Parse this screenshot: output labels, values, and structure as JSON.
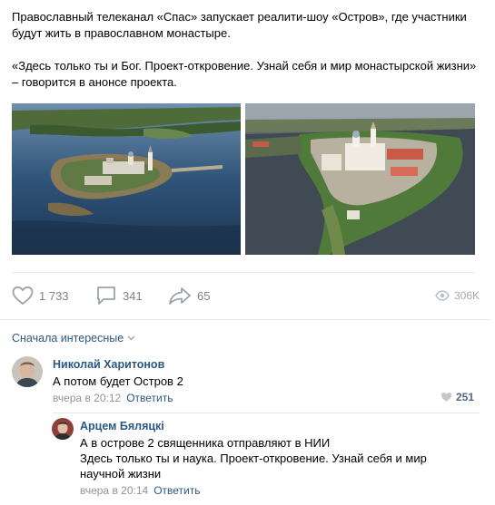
{
  "post": {
    "paragraph_1": "Православный телеканал «Спас» запускает реалити-шоу «Остров», где участники будут жить в православном монастыре.",
    "paragraph_2": "«Здесь только ты и Бог. Проект-откровение. Узнай себя и мир монастырской жизни» – говорится в анонсе проекта."
  },
  "actions": {
    "likes": "1 733",
    "comments": "341",
    "shares": "65",
    "views": "306K"
  },
  "comments_section": {
    "sort_label": "Сначала интересные"
  },
  "comments": [
    {
      "author": "Николай Харитонов",
      "text": "А потом будет Остров 2",
      "time": "вчера в 20:12",
      "reply_label": "Ответить",
      "likes": "251"
    },
    {
      "author": "Арцем Бяляцкі",
      "text_line_1": "А в острове 2 священника отправляют в НИИ",
      "text_line_2": "Здесь только ты и наука. Проект-откровение. Узнай себя и мир",
      "text_line_3": "научной жизни",
      "time": "вчера в 20:14",
      "reply_label": "Ответить"
    }
  ],
  "colors": {
    "link": "#2a5885",
    "muted": "#828282",
    "divider": "#e7e8ec"
  },
  "icons": [
    "heart-icon",
    "comment-icon",
    "share-icon",
    "eye-icon",
    "chevron-down-icon"
  ]
}
